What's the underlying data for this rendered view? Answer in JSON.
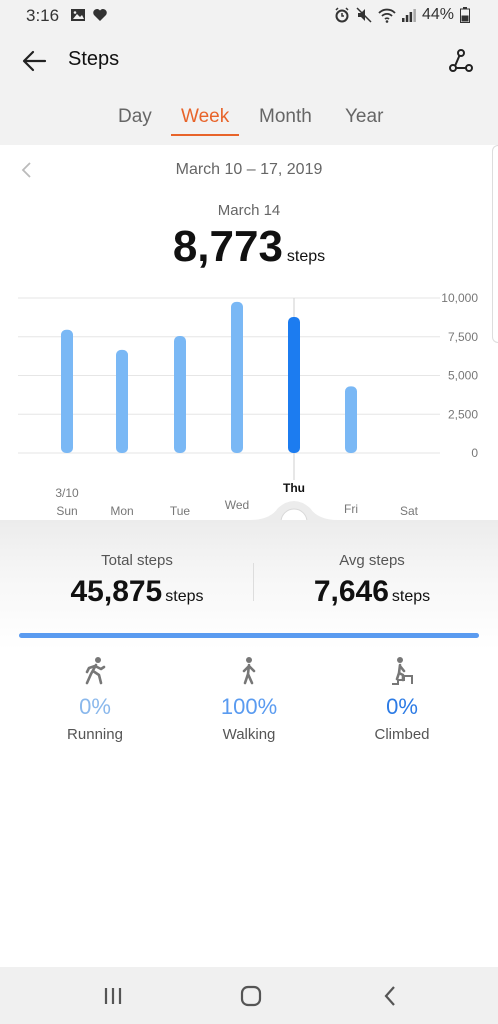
{
  "status_bar": {
    "time": "3:16",
    "battery": "44%",
    "left_icons": [
      "image-icon",
      "heart-icon"
    ],
    "right_icons": [
      "alarm-icon",
      "mute-icon",
      "wifi-icon",
      "signal-icon",
      "battery-icon"
    ]
  },
  "app_bar": {
    "title": "Steps"
  },
  "tabs": [
    {
      "label": "Day",
      "active": false
    },
    {
      "label": "Week",
      "active": true
    },
    {
      "label": "Month",
      "active": false
    },
    {
      "label": "Year",
      "active": false
    }
  ],
  "week_nav": {
    "range": "March 10 – 17, 2019"
  },
  "selected": {
    "date": "March 14",
    "value": "8,773",
    "unit": "steps"
  },
  "chart_data": {
    "type": "bar",
    "categories": [
      "Sun",
      "Mon",
      "Tue",
      "Wed",
      "Thu",
      "Fri",
      "Sat"
    ],
    "category_date_label": "3/10",
    "values": [
      7950,
      6650,
      7550,
      9750,
      8773,
      4300,
      0
    ],
    "selected_index": 4,
    "ylim": [
      0,
      10000
    ],
    "y_ticks": [
      "10,000",
      "7,500",
      "5,000",
      "2,500",
      "0"
    ],
    "y_tick_values": [
      10000,
      7500,
      5000,
      2500,
      0
    ],
    "bar_color": "#7ab8f5",
    "selected_color": "#1c7cf0",
    "grid": true
  },
  "summary": {
    "total_label": "Total steps",
    "total_value": "45,875",
    "total_unit": "steps",
    "avg_label": "Avg steps",
    "avg_value": "7,646",
    "avg_unit": "steps",
    "walking_fraction": 1.0
  },
  "activities": [
    {
      "icon": "running-icon",
      "percent": "0%",
      "label": "Running",
      "color": "#8ab8ec"
    },
    {
      "icon": "walking-icon",
      "percent": "100%",
      "label": "Walking",
      "color": "#5a9bf0"
    },
    {
      "icon": "climbing-icon",
      "percent": "0%",
      "label": "Climbed",
      "color": "#2c7be5"
    }
  ],
  "nav_bar": {
    "items": [
      "recents-icon",
      "home-icon",
      "back-icon"
    ]
  }
}
